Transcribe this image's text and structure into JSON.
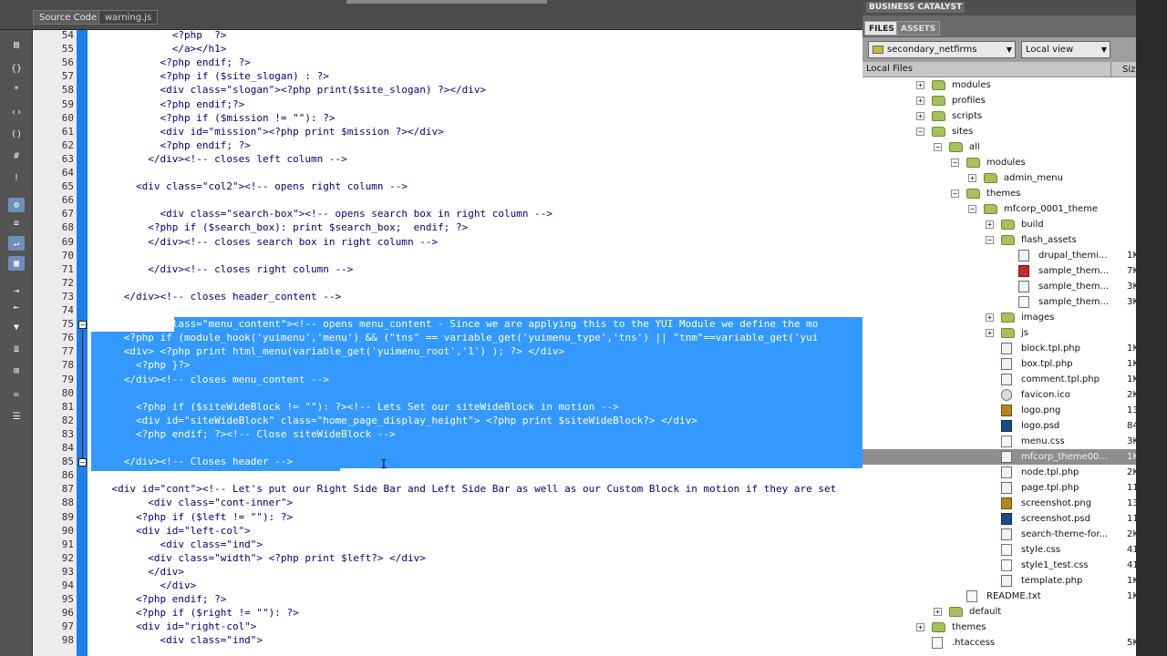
{
  "editor": {
    "tabs": [
      "Source Code",
      "warning.js"
    ],
    "lines": [
      {
        "n": 54,
        "text": "              <?php  ?>",
        "sel": false
      },
      {
        "n": 55,
        "text": "              </a></h1>",
        "sel": false
      },
      {
        "n": 56,
        "text": "            <?php endif; ?>",
        "sel": false
      },
      {
        "n": 57,
        "text": "            <?php if ($site_slogan) : ?>",
        "sel": false
      },
      {
        "n": 58,
        "text": "            <div class=\"slogan\"><?php print($site_slogan) ?></div>",
        "sel": false
      },
      {
        "n": 59,
        "text": "            <?php endif;?>",
        "sel": false
      },
      {
        "n": 60,
        "text": "            <?php if ($mission != \"\"): ?>",
        "sel": false
      },
      {
        "n": 61,
        "text": "            <div id=\"mission\"><?php print $mission ?></div>",
        "sel": false
      },
      {
        "n": 62,
        "text": "            <?php endif; ?>",
        "sel": false
      },
      {
        "n": 63,
        "text": "          </div><!-- closes left column -->",
        "sel": false
      },
      {
        "n": 64,
        "text": "",
        "sel": false
      },
      {
        "n": 65,
        "text": "        <div class=\"col2\"><!-- opens right column -->",
        "sel": false
      },
      {
        "n": 66,
        "text": "",
        "sel": false
      },
      {
        "n": 67,
        "text": "            <div class=\"search-box\"><!-- opens search box in right column -->",
        "sel": false
      },
      {
        "n": 68,
        "text": "          <?php if ($search_box): print $search_box;  endif; ?>",
        "sel": false
      },
      {
        "n": 69,
        "text": "          </div><!-- closes search box in right column -->",
        "sel": false
      },
      {
        "n": 70,
        "text": "",
        "sel": false
      },
      {
        "n": 71,
        "text": "          </div><!-- closes right column -->",
        "sel": false
      },
      {
        "n": 72,
        "text": "",
        "sel": false
      },
      {
        "n": 73,
        "text": "      </div><!-- closes header_content -->",
        "sel": false
      },
      {
        "n": 74,
        "text": "",
        "sel": false
      },
      {
        "n": 75,
        "text": "        <div class=\"menu_content\"><!-- opens menu_content - Since we are applying this to the YUI Module we define the mo",
        "sel": true
      },
      {
        "n": 76,
        "text": "      <?php if (module_hook('yuimenu','menu') && (\"tns\" == variable_get('yuimenu_type','tns') || \"tnm\"==variable_get('yui",
        "sel": true
      },
      {
        "n": 77,
        "text": "      <div> <?php print html_menu(variable_get('yuimenu_root','1') ); ?> </div>",
        "sel": true
      },
      {
        "n": 78,
        "text": "        <?php }?>",
        "sel": true
      },
      {
        "n": 79,
        "text": "      </div><!-- closes menu_content -->",
        "sel": true
      },
      {
        "n": 80,
        "text": "",
        "sel": true
      },
      {
        "n": 81,
        "text": "        <?php if ($siteWideBlock != \"\"): ?><!-- Lets Set our siteWideBlock in motion -->",
        "sel": true
      },
      {
        "n": 82,
        "text": "        <div id=\"siteWideBlock\" class=\"home_page_display_height\"> <?php print $siteWideBlock?> </div>",
        "sel": true
      },
      {
        "n": 83,
        "text": "        <?php endif; ?><!-- Close siteWideBlock -->",
        "sel": true
      },
      {
        "n": 84,
        "text": "",
        "sel": true
      },
      {
        "n": 85,
        "text": "      </div><!-- Closes header -->",
        "sel": true
      },
      {
        "n": 86,
        "text": "",
        "sel": false
      },
      {
        "n": 87,
        "text": "    <div id=\"cont\"><!-- Let's put our Right Side Bar and Left Side Bar as well as our Custom Block in motion if they are set",
        "sel": false
      },
      {
        "n": 88,
        "text": "          <div class=\"cont-inner\">",
        "sel": false
      },
      {
        "n": 89,
        "text": "        <?php if ($left != \"\"): ?>",
        "sel": false
      },
      {
        "n": 90,
        "text": "        <div id=\"left-col\">",
        "sel": false
      },
      {
        "n": 91,
        "text": "            <div class=\"ind\">",
        "sel": false
      },
      {
        "n": 92,
        "text": "          <div class=\"width\"> <?php print $left?> </div>",
        "sel": false
      },
      {
        "n": 93,
        "text": "          </div>",
        "sel": false
      },
      {
        "n": 94,
        "text": "            </div>",
        "sel": false
      },
      {
        "n": 95,
        "text": "        <?php endif; ?>",
        "sel": false
      },
      {
        "n": 96,
        "text": "        <?php if ($right != \"\"): ?>",
        "sel": false
      },
      {
        "n": 97,
        "text": "        <div id=\"right-col\">",
        "sel": false
      },
      {
        "n": 98,
        "text": "            <div class=\"ind\">",
        "sel": false
      }
    ]
  },
  "panel": {
    "title": "BUSINESS CATALYST",
    "tabs": [
      "FILES",
      "ASSETS"
    ],
    "site_select": "secondary_netfirms",
    "view_select": "Local view",
    "col_local": "Local Files",
    "col_size": "Siz",
    "tree": [
      {
        "depth": 0,
        "exp": "+",
        "icon": "folder",
        "name": "modules",
        "size": ""
      },
      {
        "depth": 0,
        "exp": "+",
        "icon": "folder",
        "name": "profiles",
        "size": ""
      },
      {
        "depth": 0,
        "exp": "+",
        "icon": "folder",
        "name": "scripts",
        "size": ""
      },
      {
        "depth": 0,
        "exp": "-",
        "icon": "folder",
        "name": "sites",
        "size": ""
      },
      {
        "depth": 1,
        "exp": "-",
        "icon": "folder",
        "name": "all",
        "size": ""
      },
      {
        "depth": 2,
        "exp": "-",
        "icon": "folder",
        "name": "modules",
        "size": ""
      },
      {
        "depth": 3,
        "exp": "+",
        "icon": "folder",
        "name": "admin_menu",
        "size": ""
      },
      {
        "depth": 2,
        "exp": "-",
        "icon": "folder",
        "name": "themes",
        "size": ""
      },
      {
        "depth": 3,
        "exp": "-",
        "icon": "folder",
        "name": "mfcorp_0001_theme",
        "size": ""
      },
      {
        "depth": 4,
        "exp": "+",
        "icon": "folder",
        "name": "build",
        "size": ""
      },
      {
        "depth": 4,
        "exp": "-",
        "icon": "folder",
        "name": "flash_assets",
        "size": ""
      },
      {
        "depth": 5,
        "exp": "",
        "icon": "php",
        "name": "drupal_themi...",
        "size": "1K"
      },
      {
        "depth": 5,
        "exp": "",
        "icon": "pdf",
        "name": "sample_them...",
        "size": "7K"
      },
      {
        "depth": 5,
        "exp": "",
        "icon": "php",
        "name": "sample_them...",
        "size": "3K"
      },
      {
        "depth": 5,
        "exp": "",
        "icon": "file",
        "name": "sample_them...",
        "size": "3K"
      },
      {
        "depth": 4,
        "exp": "+",
        "icon": "folder",
        "name": "images",
        "size": ""
      },
      {
        "depth": 4,
        "exp": "+",
        "icon": "folder",
        "name": "js",
        "size": ""
      },
      {
        "depth": 4,
        "exp": "",
        "icon": "php",
        "name": "block.tpl.php",
        "size": "1K"
      },
      {
        "depth": 4,
        "exp": "",
        "icon": "php",
        "name": "box.tpl.php",
        "size": "1K"
      },
      {
        "depth": 4,
        "exp": "",
        "icon": "php",
        "name": "comment.tpl.php",
        "size": "1K"
      },
      {
        "depth": 4,
        "exp": "",
        "icon": "ico",
        "name": "favicon.ico",
        "size": "2K"
      },
      {
        "depth": 4,
        "exp": "",
        "icon": "png",
        "name": "logo.png",
        "size": "13K"
      },
      {
        "depth": 4,
        "exp": "",
        "icon": "psd",
        "name": "logo.psd",
        "size": "84K"
      },
      {
        "depth": 4,
        "exp": "",
        "icon": "file",
        "name": "menu.css",
        "size": "3K"
      },
      {
        "depth": 4,
        "exp": "",
        "icon": "php",
        "name": "mfcorp_theme00...",
        "size": "1K",
        "selected": true
      },
      {
        "depth": 4,
        "exp": "",
        "icon": "php",
        "name": "node.tpl.php",
        "size": "2K"
      },
      {
        "depth": 4,
        "exp": "",
        "icon": "php",
        "name": "page.tpl.php",
        "size": "11K"
      },
      {
        "depth": 4,
        "exp": "",
        "icon": "png",
        "name": "screenshot.png",
        "size": "13K"
      },
      {
        "depth": 4,
        "exp": "",
        "icon": "psd",
        "name": "screenshot.psd",
        "size": "113K"
      },
      {
        "depth": 4,
        "exp": "",
        "icon": "php",
        "name": "search-theme-for...",
        "size": "2K"
      },
      {
        "depth": 4,
        "exp": "",
        "icon": "file",
        "name": "style.css",
        "size": "41K"
      },
      {
        "depth": 4,
        "exp": "",
        "icon": "file",
        "name": "style1_test.css",
        "size": "41K"
      },
      {
        "depth": 4,
        "exp": "",
        "icon": "php",
        "name": "template.php",
        "size": "1K"
      },
      {
        "depth": 2,
        "exp": "",
        "icon": "file",
        "name": "README.txt",
        "size": "1K"
      },
      {
        "depth": 1,
        "exp": "+",
        "icon": "folder",
        "name": "default",
        "size": ""
      },
      {
        "depth": 0,
        "exp": "+",
        "icon": "folder",
        "name": "themes",
        "size": ""
      },
      {
        "depth": 0,
        "exp": "",
        "icon": "file",
        "name": ".htaccess",
        "size": "5K"
      }
    ]
  },
  "colors": {
    "selection": "#3399ff",
    "code_text": "#000080",
    "gutter_bar": "#1e7fe8",
    "panel_header": "#4f4f4f",
    "folder": "#a7c15e"
  }
}
